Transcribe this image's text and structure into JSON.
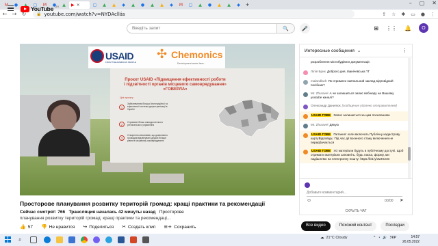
{
  "browser": {
    "active_tab_icon": "youtube-icon",
    "url": "youtube.com/watch?v=NYDAcllás"
  },
  "header": {
    "logo_text": "YouTube",
    "logo_region": "UA",
    "search_placeholder": "Введіть запит",
    "avatar_letter": "O"
  },
  "video": {
    "title": "Просторове планування розвитку територій громад: кращі практики та рекомендації",
    "viewers": "Сейчас смотрят: 766",
    "started": "Трансляция началась 42 минуты назад",
    "desc_start": "Просторове",
    "desc_line2": "планування розвитку територій громад: кращі практики та рекомендаці...",
    "slide": {
      "logo_usaid": "USAID",
      "logo_usaid_sub": "FROM THE AMERICAN PEOPLE",
      "logo_chemonics": "Chemonics",
      "logo_chemonics_sub": "Development works here.",
      "title": "Проєкт USAID «Підвищення ефективності роботи і підзвітності органів місцевого самоврядування» «ГОВЕРЛА»",
      "goals_label": "Цілі проєкту",
      "goals": [
        {
          "n": "1",
          "text": "Забезпечення більшої інституційної та ефективної системи децентралізації в Україні"
        },
        {
          "n": "2",
          "text": "Стримане більш самодостатнього регіонального управління"
        },
        {
          "n": "3",
          "text": "Створення механізмів, що дозволяють громадам відзвітувати дедалі більше рівню в місцевому самоврядуванні"
        }
      ]
    }
  },
  "actions": {
    "likes": "57",
    "dislike": "Не нравится",
    "share": "Поделиться",
    "clip": "Создать клип",
    "save": "Сохранить"
  },
  "chips": [
    "Все видео",
    "Похожий контент",
    "Последни"
  ],
  "chat": {
    "header": "Интересные сообщения",
    "messages": [
      {
        "author": "",
        "text": "розроблення містобудівної документації.",
        "color": "#ffffff",
        "tag": false
      },
      {
        "author": "Лілія Брих",
        "text": "Доброго дня, Іванічевська ТГ",
        "color": "#f48fb1",
        "tag": false
      },
      {
        "author": "malandlach",
        "text": "Як отримати навчальний заклад відповідний посібник?",
        "color": "#90a4ae",
        "tag": false
      },
      {
        "author": "Mr. Zhuravel",
        "text": "А чи залишиться запис вебінару на Вашому youtube каналі?",
        "color": "#607d8b",
        "tag": false
      },
      {
        "author": "Олександр Данилюк",
        "text": "[сообщение удалено отправителем]",
        "color": "#7e57c2",
        "tag": false
      },
      {
        "author": "USAID ГОВЕ",
        "text": "Запис залишиться за цим посиланням",
        "color": "#f08a24",
        "tag": true
      },
      {
        "author": "Mr. Zhuravel",
        "text": "Дякую",
        "color": "#607d8b",
        "tag": false
      },
      {
        "author": "USAID ГОВЕ",
        "text": "Питання: коли включать Публічну кадастрову картуВідповідь: Під час дії воєнного стану включення не передбачається",
        "color": "#f08a24",
        "tag": true
      },
      {
        "author": "USAID ГОВЕ",
        "text": "Усі матеріали будуть в публічному доступі. Щоб отримати матеріали заповніть, будь ласка, форму, ми надішлемо на електронну пошту: https://bit.ly/3wKC0m",
        "color": "#f08a24",
        "tag": true
      }
    ],
    "input_placeholder": "Добавьте комментарий...",
    "char_count": "0/200",
    "hide_chat": "СКРЫТЬ ЧАТ"
  },
  "taskbar": {
    "weather": "21°C Cloudy",
    "lang": "УКР",
    "time": "14:57",
    "date": "26.05.2022"
  },
  "colors": {
    "brand_red": "#ff0000",
    "usaid_navy": "#1a3e7a",
    "chemonics_orange": "#f08a24",
    "slide_title_red": "#c0392b"
  }
}
